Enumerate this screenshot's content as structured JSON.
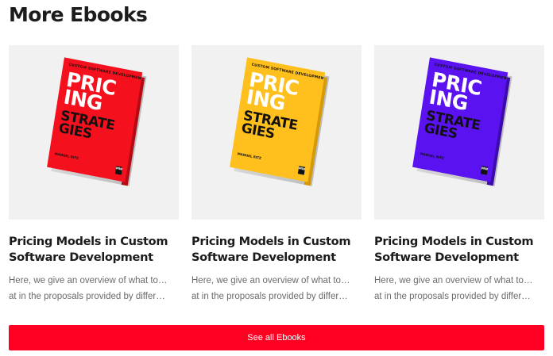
{
  "section": {
    "title": "More Ebooks"
  },
  "cards": [
    {
      "title_line1": "Pricing Models in Custom",
      "title_line2": "Software Development",
      "desc_line1": "Here, we give an overview of what to look",
      "desc_line2": "at in the proposals provided by different...",
      "cover": {
        "top_text": "Custom Software Development",
        "big1_line1": "PRIC",
        "big1_line2": "ING",
        "big2_line1": "STRATE",
        "big2_line2": "GIES",
        "author": "Manuel Ritz",
        "logo": "MW",
        "cover_color": "#f5101e",
        "spine_color": "#b40a14"
      }
    },
    {
      "title_line1": "Pricing Models in Custom",
      "title_line2": "Software Development",
      "desc_line1": "Here, we give an overview of what to look",
      "desc_line2": "at in the proposals provided by different...",
      "cover": {
        "top_text": "Custom Software Development",
        "big1_line1": "PRIC",
        "big1_line2": "ING",
        "big2_line1": "STRATE",
        "big2_line2": "GIES",
        "author": "Manuel Ritz",
        "logo": "MW",
        "cover_color": "#ffbf1c",
        "spine_color": "#d49a0a"
      }
    },
    {
      "title_line1": "Pricing Models in Custom",
      "title_line2": "Software Development",
      "desc_line1": "Here, we give an overview of what to look",
      "desc_line2": "at in the proposals provided by different...",
      "cover": {
        "top_text": "Custom Software Development",
        "big1_line1": "PRIC",
        "big1_line2": "ING",
        "big2_line1": "STRATE",
        "big2_line2": "GIES",
        "author": "Manuel Ritz",
        "logo": "MW",
        "cover_color": "#5a12f0",
        "spine_color": "#3d0aab"
      }
    }
  ],
  "cta": {
    "label": "See all Ebooks",
    "color": "#ff0022"
  }
}
